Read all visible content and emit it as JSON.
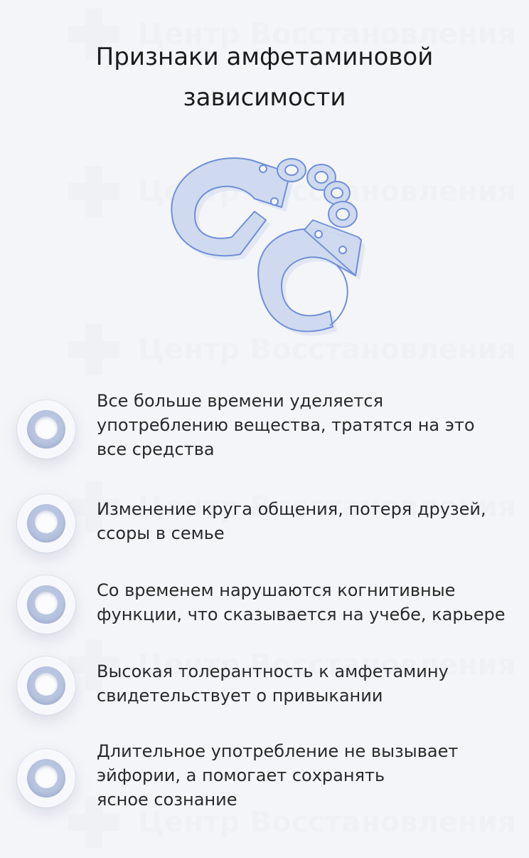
{
  "watermark": {
    "text": "Центр Восстановления"
  },
  "title": "Признаки амфетаминовой\nзависимости",
  "illustration": {
    "icon": "handcuffs-icon",
    "colors": {
      "fill": "#cfdaf0",
      "stroke": "#6f8fd8"
    }
  },
  "items": [
    {
      "text": "Все больше времени уделяется\nупотреблению вещества, тратятся на это\nвсе средства"
    },
    {
      "text": "Изменение круга общения, потеря друзей,\nссоры в семье"
    },
    {
      "text": "Со временем нарушаются когнитивные\nфункции, что сказывается  на учебе, карьере"
    },
    {
      "text": "Высокая толерантность к амфетамину\nсвидетельствует о привыкании"
    },
    {
      "text": "Длительное употребление не вызывает\nэйфории, а помогает сохранять\nясное сознание"
    }
  ],
  "colors": {
    "background": "#f4f5f9",
    "bullet_ring": "#b8c5e0",
    "text": "#2a2a2a"
  }
}
